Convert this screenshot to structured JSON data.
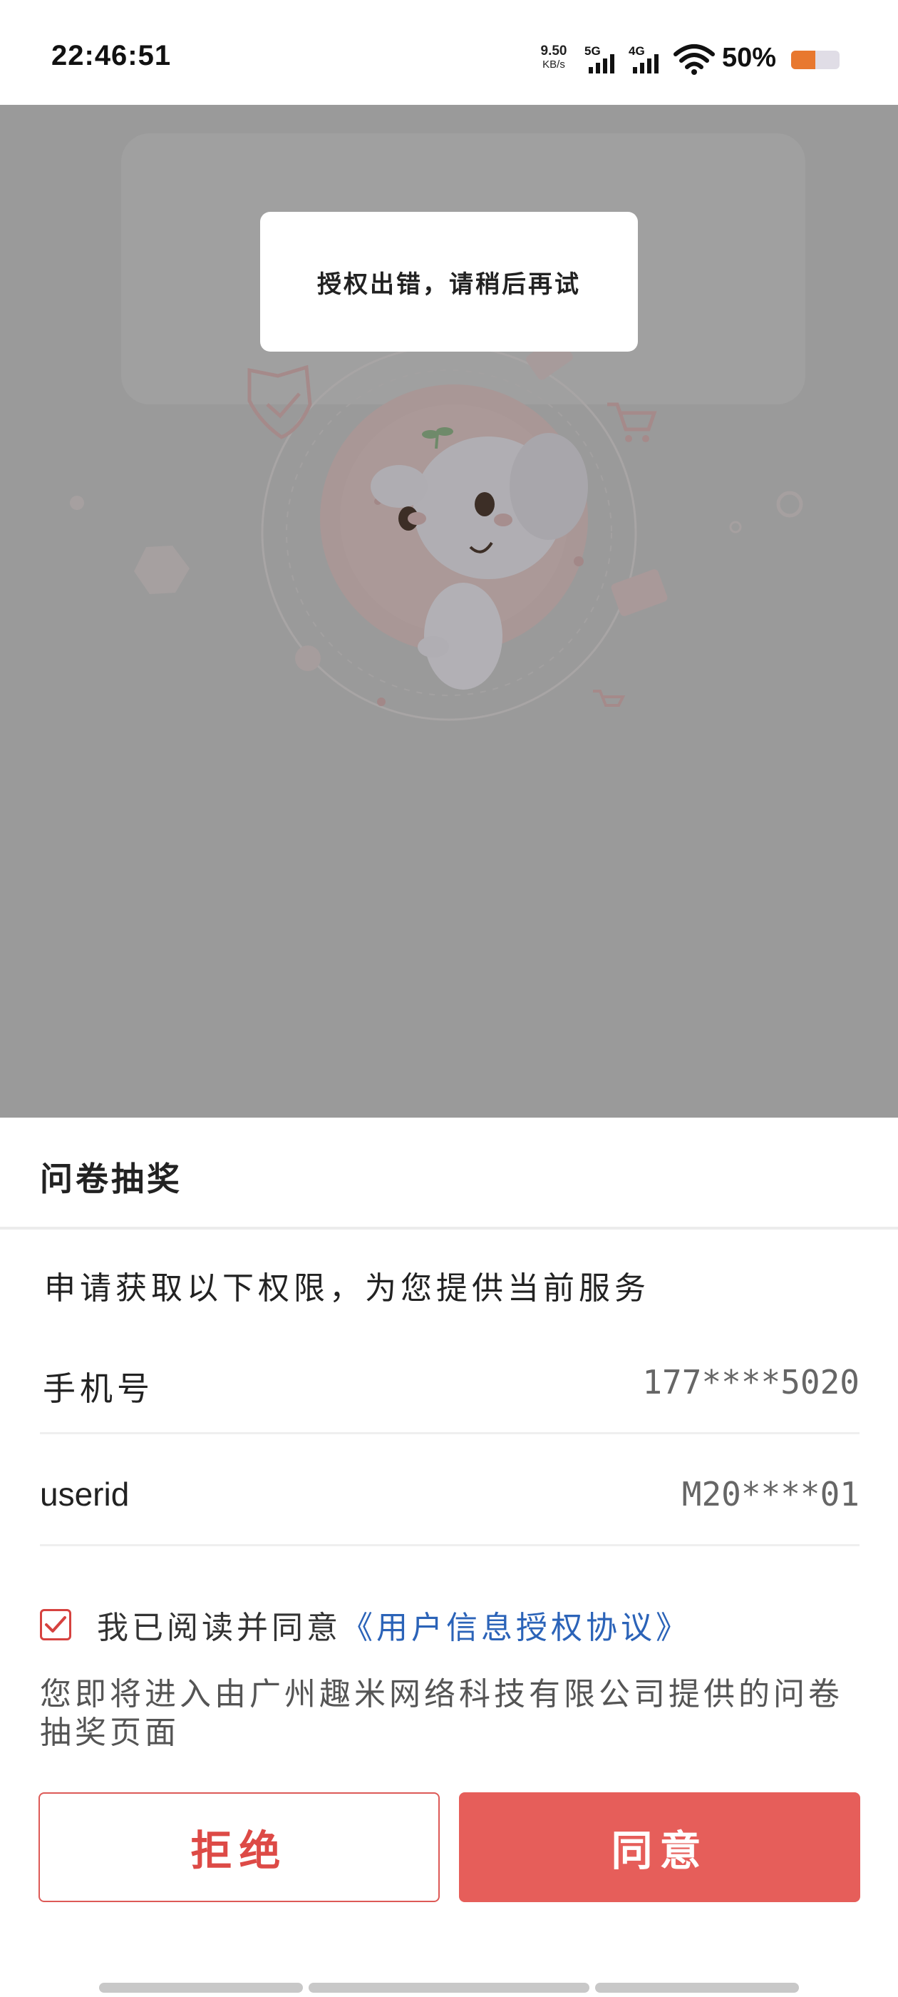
{
  "status_bar": {
    "time": "22:46:51",
    "net_speed_value": "9.50",
    "net_speed_unit": "KB/s",
    "signal_1_label": "5G",
    "signal_2_label": "4G",
    "battery_text": "50%",
    "battery_level": 0.5,
    "battery_color": "#e8782f"
  },
  "toast": {
    "message": "授权出错，请稍后再试"
  },
  "sheet": {
    "title": "问卷抽奖",
    "intro": "申请获取以下权限，为您提供当前服务",
    "permissions": [
      {
        "label": "手机号",
        "value": "177****5020"
      },
      {
        "label": "userid",
        "value": "M20****01"
      }
    ],
    "agree_checked": true,
    "agree_text": "我已阅读并同意",
    "agreement_link": "《用户信息授权协议》",
    "notice": "您即将进入由广州趣米网络科技有限公司提供的问卷抽奖页面",
    "reject_label": "拒绝",
    "agree_label": "同意"
  },
  "colors": {
    "accent_red": "#e65e5a",
    "link_blue": "#2b63b8",
    "overlay_gray": "#9a9a9a"
  }
}
